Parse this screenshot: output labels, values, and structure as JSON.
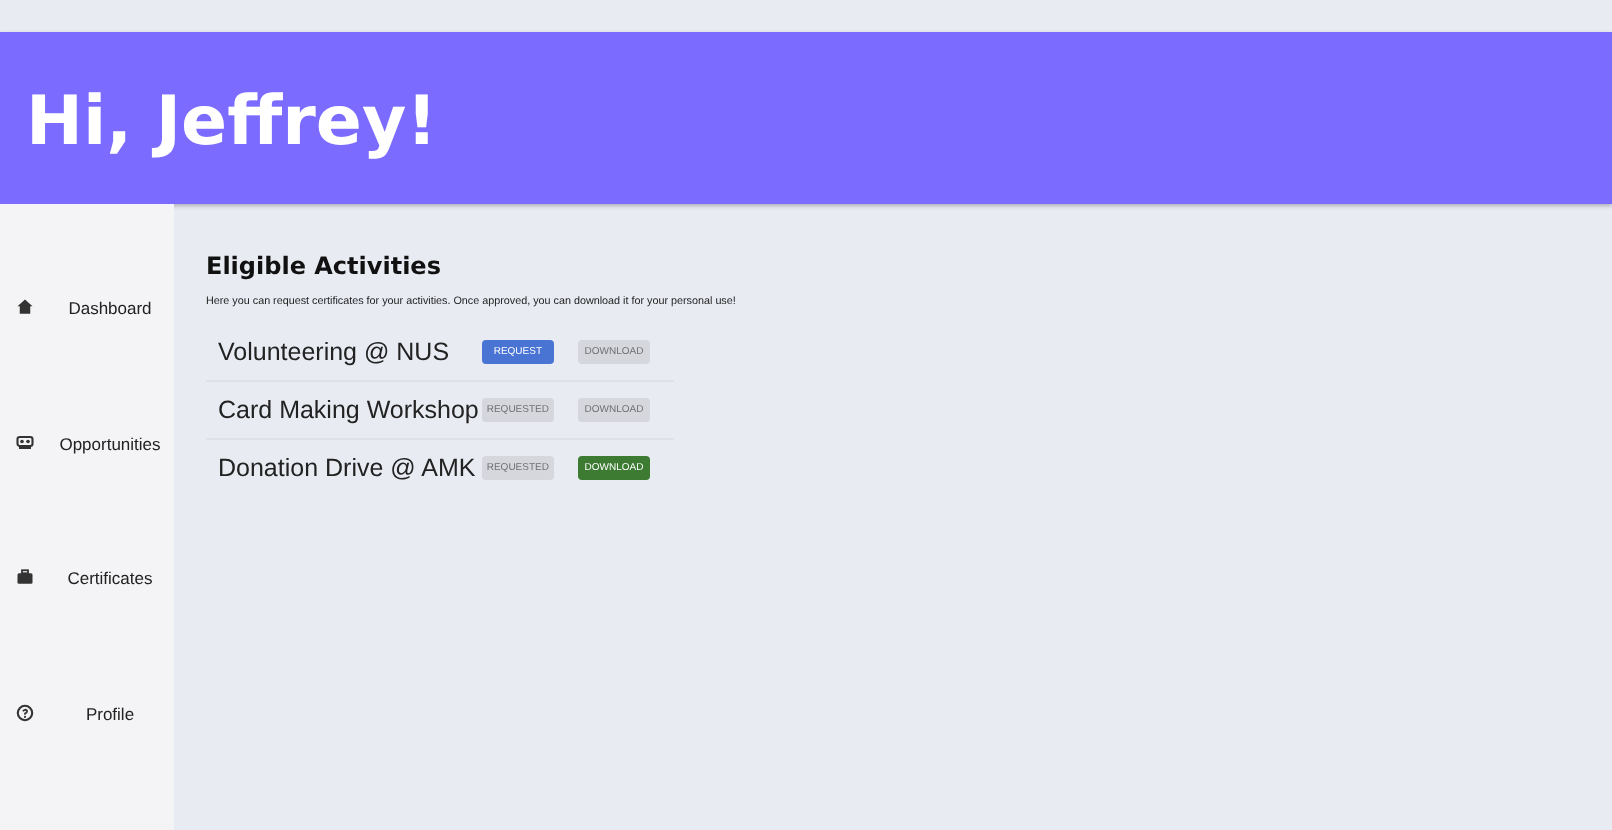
{
  "header": {
    "greeting": "Hi, Jeffrey!"
  },
  "sidebar": {
    "items": [
      {
        "label": "Dashboard"
      },
      {
        "label": "Opportunities"
      },
      {
        "label": "Certificates"
      },
      {
        "label": "Profile"
      }
    ]
  },
  "main": {
    "title": "Eligible Activities",
    "description": "Here you can request certificates for your activities. Once approved, you can download it for your personal use!",
    "activities": [
      {
        "name": "Volunteering @ NUS",
        "buttons": [
          {
            "kind": "request",
            "label": "REQUEST",
            "disabled": false
          },
          {
            "kind": "download",
            "label": "DOWNLOAD",
            "disabled": true
          }
        ]
      },
      {
        "name": "Card Making Workshop",
        "buttons": [
          {
            "kind": "request",
            "label": "REQUESTED",
            "disabled": true
          },
          {
            "kind": "download",
            "label": "DOWNLOAD",
            "disabled": true
          }
        ]
      },
      {
        "name": "Donation Drive @ AMK",
        "buttons": [
          {
            "kind": "request",
            "label": "REQUESTED",
            "disabled": true
          },
          {
            "kind": "download",
            "label": "DOWNLOAD",
            "disabled": false
          }
        ]
      }
    ]
  }
}
